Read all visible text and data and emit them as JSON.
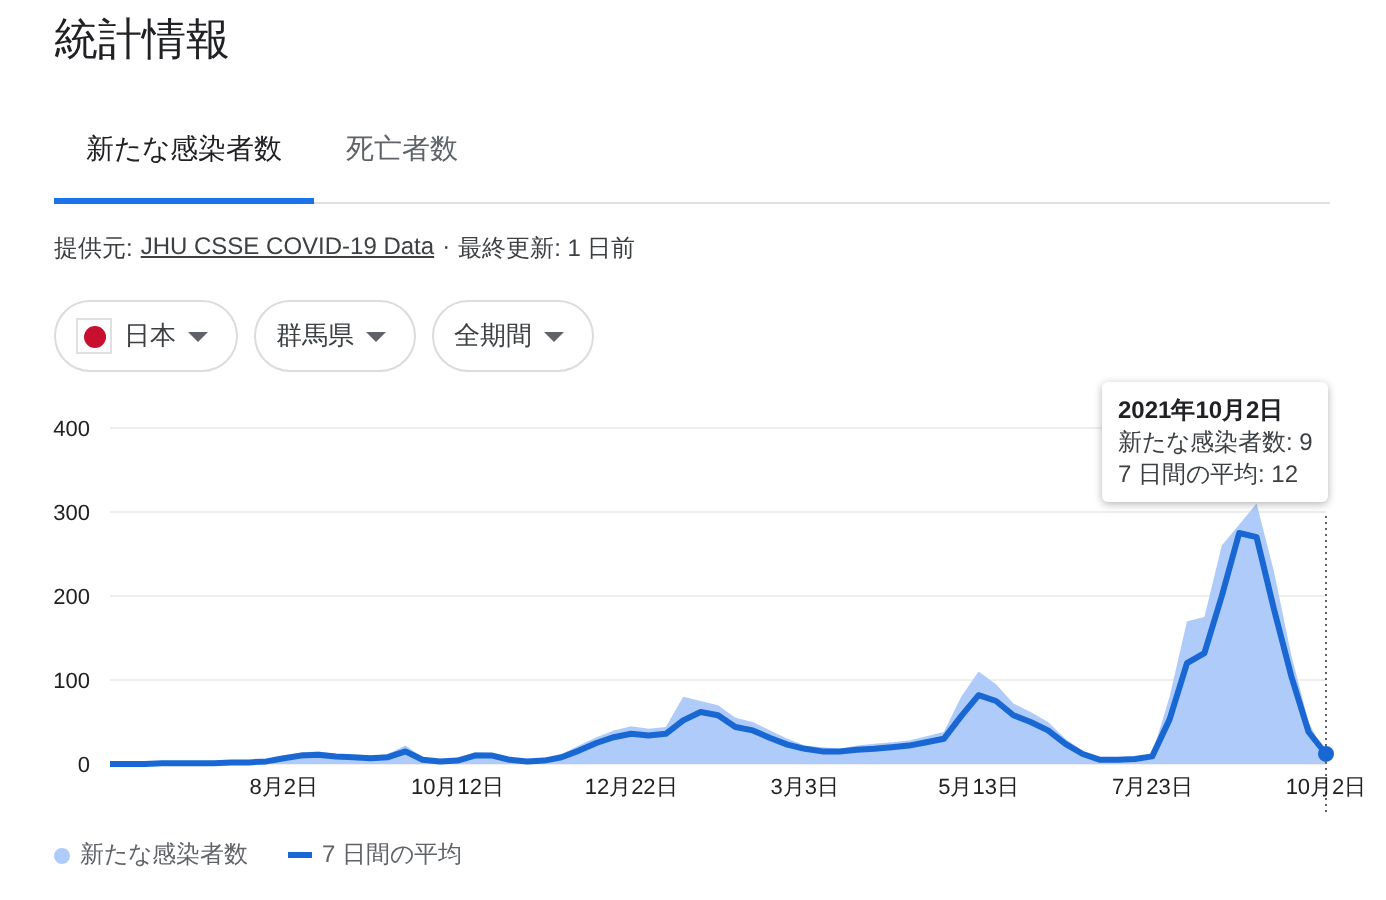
{
  "title": "統計情報",
  "tabs": [
    {
      "label": "新たな感染者数",
      "selected": true
    },
    {
      "label": "死亡者数",
      "selected": false
    }
  ],
  "source": {
    "prefix": "提供元:",
    "link": "JHU CSSE COVID-19 Data",
    "separator": "·",
    "updated": "最終更新: 1 日前"
  },
  "filters": [
    {
      "kind": "flag",
      "label": "日本"
    },
    {
      "kind": "plain",
      "label": "群馬県"
    },
    {
      "kind": "plain",
      "label": "全期間"
    }
  ],
  "chart_data": {
    "type": "area",
    "ylim": [
      0,
      400
    ],
    "yticks": [
      0,
      100,
      200,
      300,
      400
    ],
    "grid": true,
    "categories": [
      null,
      null,
      null,
      null,
      null,
      null,
      null,
      null,
      null,
      null,
      "8月2日",
      null,
      null,
      null,
      null,
      null,
      null,
      null,
      null,
      null,
      "10月12日",
      null,
      null,
      null,
      null,
      null,
      null,
      null,
      null,
      null,
      "12月22日",
      null,
      null,
      null,
      null,
      null,
      null,
      null,
      null,
      null,
      "3月3日",
      null,
      null,
      null,
      null,
      null,
      null,
      null,
      null,
      null,
      "5月13日",
      null,
      null,
      null,
      null,
      null,
      null,
      null,
      null,
      null,
      "7月23日",
      null,
      null,
      null,
      null,
      null,
      null,
      null,
      null,
      null,
      "10月2日"
    ],
    "series": [
      {
        "name": "新たな感染者数",
        "color": "#aecbfa",
        "values": [
          0,
          0,
          0,
          1,
          2,
          1,
          2,
          3,
          3,
          5,
          10,
          14,
          15,
          12,
          10,
          9,
          12,
          22,
          8,
          4,
          5,
          14,
          13,
          7,
          4,
          6,
          12,
          22,
          32,
          40,
          45,
          42,
          44,
          80,
          75,
          70,
          55,
          50,
          40,
          30,
          22,
          20,
          18,
          22,
          24,
          26,
          28,
          33,
          38,
          80,
          110,
          95,
          72,
          62,
          50,
          30,
          15,
          7,
          6,
          8,
          12,
          80,
          170,
          175,
          260,
          null,
          310,
          230,
          130,
          50,
          9
        ]
      },
      {
        "name": "7 日間の平均",
        "color": "#1967d2",
        "type": "line",
        "values": [
          0,
          0,
          0,
          1,
          1,
          1,
          1,
          2,
          2,
          3,
          7,
          10,
          11,
          9,
          8,
          7,
          8,
          15,
          5,
          3,
          4,
          10,
          10,
          5,
          3,
          4,
          8,
          16,
          25,
          32,
          36,
          34,
          36,
          52,
          62,
          58,
          44,
          40,
          31,
          23,
          18,
          15,
          15,
          17,
          18,
          20,
          22,
          26,
          30,
          57,
          82,
          75,
          58,
          50,
          40,
          24,
          12,
          5,
          5,
          6,
          9,
          53,
          120,
          132,
          200,
          275,
          270,
          185,
          105,
          38,
          12
        ]
      }
    ]
  },
  "tooltip": {
    "date": "2021年10月2日",
    "lines": [
      "新たな感染者数: 9",
      "7 日間の平均: 12"
    ]
  }
}
